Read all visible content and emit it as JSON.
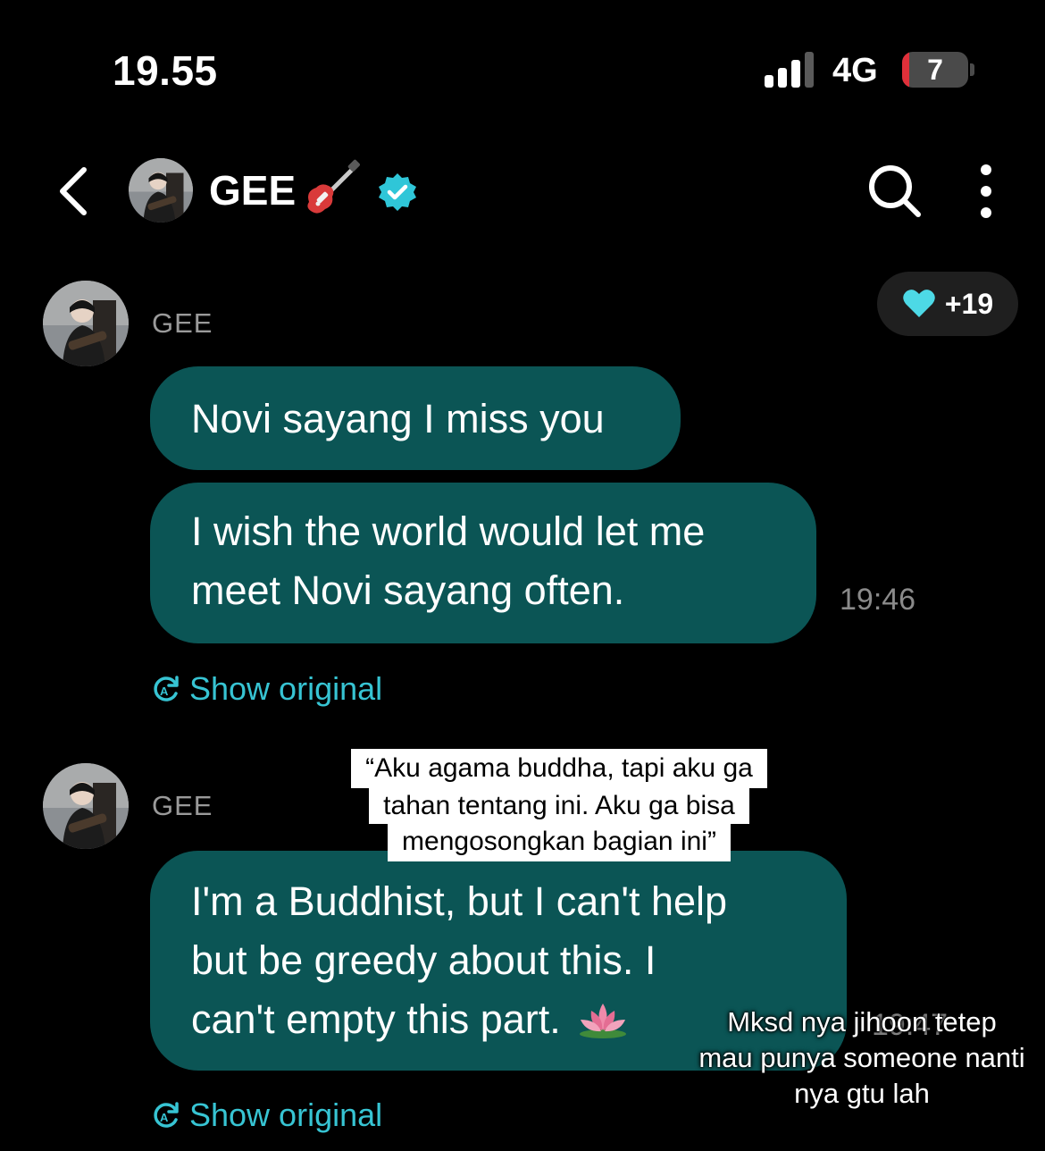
{
  "status_bar": {
    "time": "19.55",
    "network": "4G",
    "battery": "7",
    "battery_color": "#e0303a",
    "signal_bars_active": 3,
    "signal_bars_total": 4
  },
  "header": {
    "title": "GEE",
    "title_emoji_icon": "guitar-icon",
    "verified_color": "#2fc6d8",
    "icons": [
      "back-arrow-icon",
      "search-icon",
      "more-vertical-icon"
    ]
  },
  "reaction": {
    "icon": "heart-icon",
    "heart_color": "#4dd9e6",
    "count": "+19"
  },
  "messages": [
    {
      "sender": "GEE",
      "lines": [
        "Novi sayang I miss you"
      ],
      "show_original": "Show original"
    },
    {
      "lines": [
        "I wish the world would let me",
        "meet Novi sayang often."
      ],
      "time": "19:46"
    },
    {
      "sender": "GEE",
      "lines": [
        "I'm a Buddhist, but I can't help",
        "but be greedy about this. I",
        "can't empty this part."
      ],
      "emoji_icon": "lotus-icon",
      "time": "19:47",
      "show_original": "Show original"
    }
  ],
  "captions": {
    "translation_lines": [
      "“Aku agama buddha, tapi aku ga",
      "tahan tentang ini. Aku ga bisa",
      "mengosongkan bagian ini”"
    ],
    "comment_lines": [
      "Mksd nya jihoon tetep",
      "mau punya someone nanti",
      "nya gtu lah"
    ]
  },
  "colors": {
    "background": "#000000",
    "bubble": "#0b5555",
    "link": "#37c4d3"
  }
}
